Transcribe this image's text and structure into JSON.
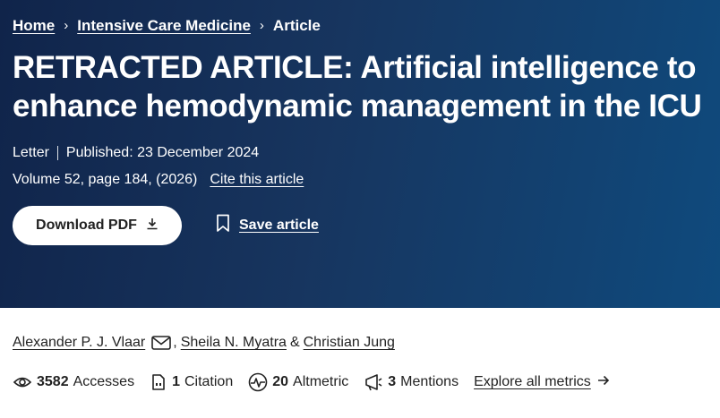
{
  "breadcrumb": {
    "items": [
      "Home",
      "Intensive Care Medicine"
    ],
    "current": "Article",
    "separator": "›"
  },
  "article": {
    "title": "RETRACTED ARTICLE: Artificial intelligence to enhance hemodynamic management in the ICU",
    "type": "Letter",
    "published": "Published: 23 December 2024",
    "volume": "Volume 52, page 184, (2026)",
    "cite_label": "Cite this article"
  },
  "actions": {
    "download_label": "Download PDF",
    "save_label": "Save article"
  },
  "authors": {
    "list": [
      "Alexander P. J. Vlaar",
      "Sheila N. Myatra",
      "Christian Jung"
    ],
    "separator": ",",
    "conjunction": "&"
  },
  "metrics": {
    "accesses": {
      "value": "3582",
      "label": "Accesses"
    },
    "citations": {
      "value": "1",
      "label": "Citation"
    },
    "altmetric": {
      "value": "20",
      "label": "Altmetric"
    },
    "mentions": {
      "value": "3",
      "label": "Mentions"
    },
    "explore_label": "Explore all metrics"
  },
  "colors": {
    "hero_start": "#10244a",
    "hero_end": "#0f4a7d",
    "text": "#222222",
    "button_bg": "#ffffff"
  },
  "icons": [
    "chevron-right-icon",
    "download-icon",
    "bookmark-icon",
    "mail-icon",
    "eye-icon",
    "citation-icon",
    "altmetric-icon",
    "megaphone-icon",
    "arrow-right-icon"
  ]
}
